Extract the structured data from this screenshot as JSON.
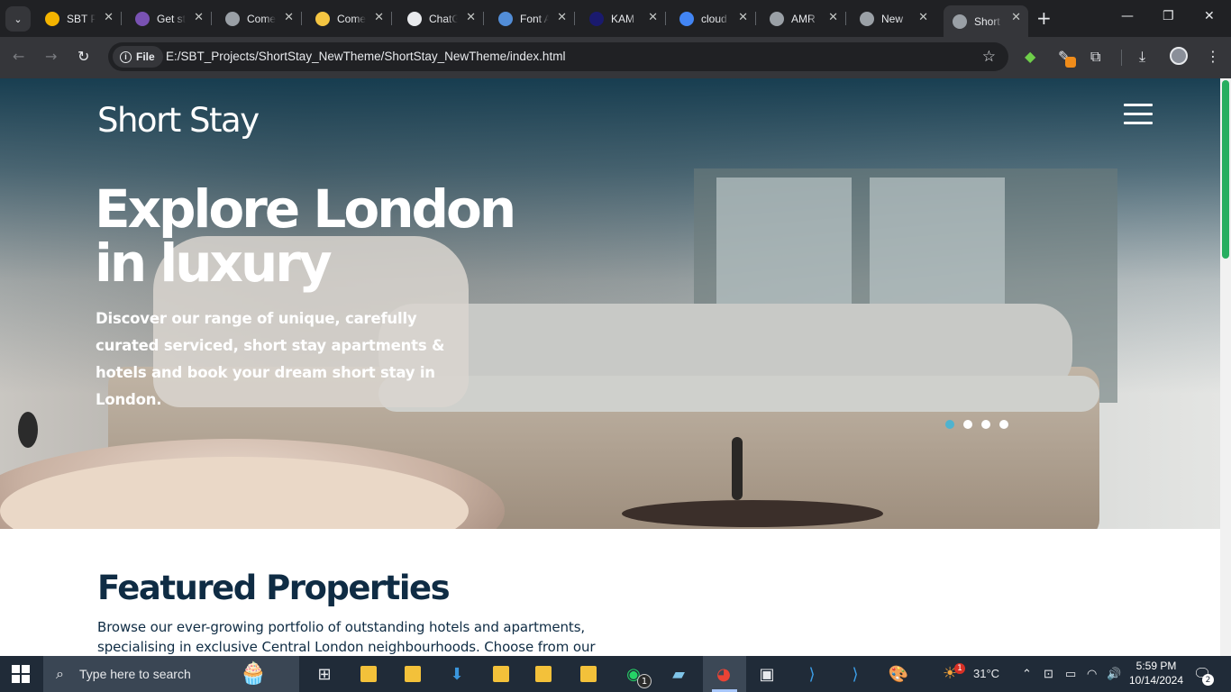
{
  "browser": {
    "tabs": [
      {
        "title": "SBT P",
        "icon": "google-drive-icon",
        "color": "#f4b400"
      },
      {
        "title": "Get st",
        "icon": "bootstrap-icon",
        "color": "#7952b3"
      },
      {
        "title": "Come",
        "icon": "globe-icon",
        "color": "#9aa0a6"
      },
      {
        "title": "Come",
        "icon": "hands-icon",
        "color": "#f4c542"
      },
      {
        "title": "ChatG",
        "icon": "chatgpt-icon",
        "color": "#e8eaed"
      },
      {
        "title": "Font A",
        "icon": "flag-icon",
        "color": "#528dd7"
      },
      {
        "title": "KAM",
        "icon": "dot-icon",
        "color": "#1a1a6e"
      },
      {
        "title": "cloud",
        "icon": "google-icon",
        "color": "#4285f4"
      },
      {
        "title": "AMR",
        "icon": "globe-icon",
        "color": "#9aa0a6"
      },
      {
        "title": "New",
        "icon": "chrome-icon",
        "color": "#9aa0a6"
      },
      {
        "title": "Short",
        "icon": "globe-icon",
        "color": "#9aa0a6"
      }
    ],
    "address": {
      "chip_label": "File",
      "url": "E:/SBT_Projects/ShortStay_NewTheme/ShortStay_NewTheme/index.html"
    }
  },
  "page": {
    "brand": "Short Stay",
    "hero": {
      "headline_line1": "Explore London",
      "headline_line2": "in luxury",
      "subheading": "Discover our range of unique, carefully curated serviced, short stay apartments & hotels and book your dream short stay in London.",
      "slide_count": 4,
      "active_slide": 1
    },
    "featured": {
      "title": "Featured Properties",
      "description": "Browse our ever-growing portfolio of outstanding hotels and apartments, specialising in exclusive Central London neighbourhoods. Choose from our"
    }
  },
  "taskbar": {
    "search_placeholder": "Type here to search",
    "whatsapp_badge": "1",
    "weather": "31°C",
    "weather_badge": "1",
    "time": "5:59 PM",
    "date": "10/14/2024",
    "notification_count": "2"
  },
  "colors": {
    "accent_dot": "#4fb3cf",
    "heading_navy": "#0f2c44",
    "scrollbar_thumb": "#27ae60"
  }
}
